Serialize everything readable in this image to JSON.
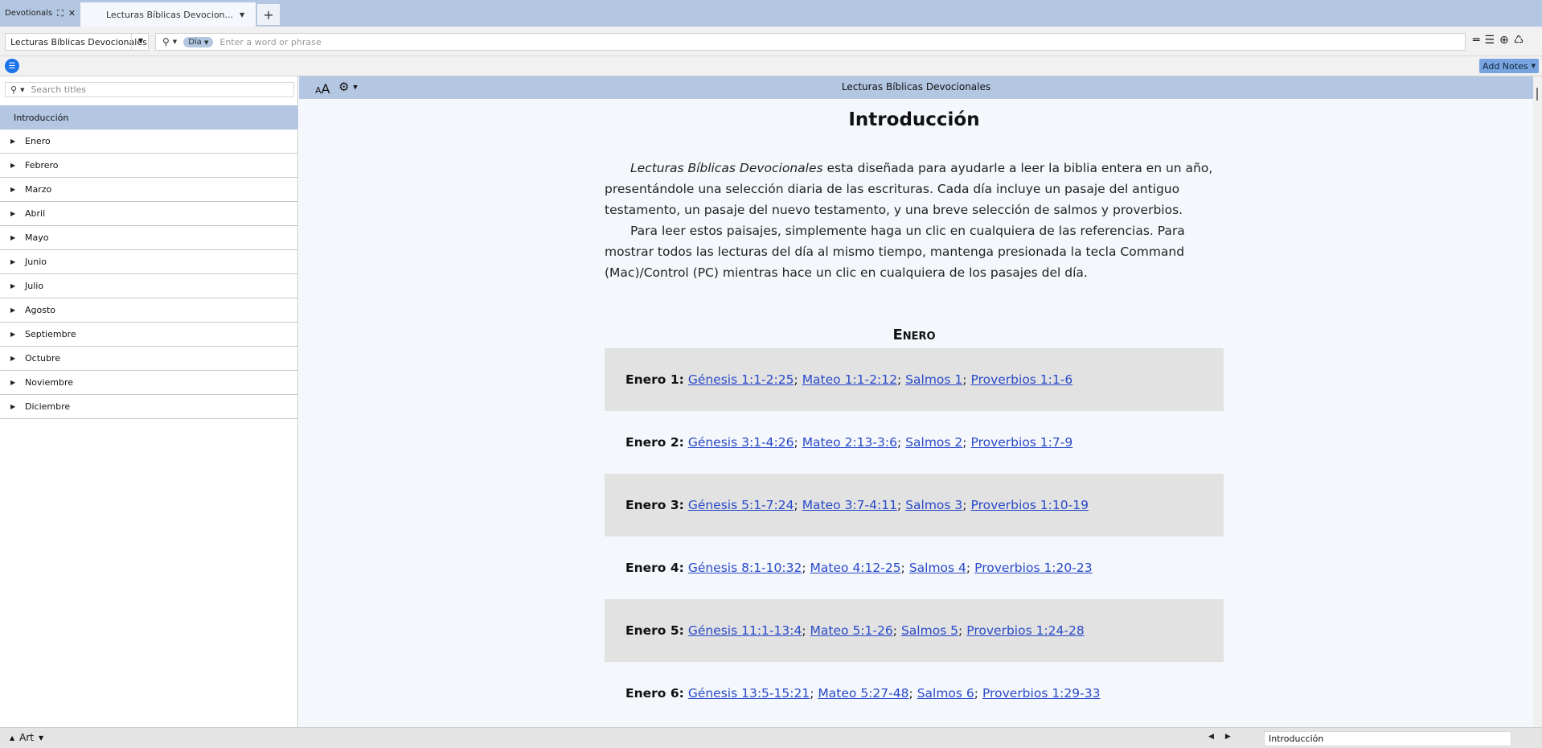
{
  "tabs": {
    "panel_tab_label": "Devotionals",
    "active_tab_label": "Lecturas Bíblicas Devocion...",
    "add_tab_label": "+"
  },
  "toolbar": {
    "resource_label": "Lecturas Bíblicas Devocionales",
    "search_scope": "Día",
    "search_placeholder": "Enter a word or phrase"
  },
  "subbar": {
    "add_notes_label": "Add Notes"
  },
  "sidebar": {
    "search_placeholder": "Search titles",
    "selected_item": "Introducción",
    "items": [
      "Enero",
      "Febrero",
      "Marzo",
      "Abril",
      "Mayo",
      "Junio",
      "Julio",
      "Agosto",
      "Septiembre",
      "Octubre",
      "Noviembre",
      "Diciembre"
    ]
  },
  "content": {
    "header_title": "Lecturas Bíblicas Devocionales",
    "font_small": "A",
    "font_large": "A",
    "page_heading": "Introducción",
    "intro_p1_italic": "Lecturas Bíblicas Devocionales",
    "intro_p1_rest": " esta diseñada para ayudarle a leer la biblia entera en un año, presentándole una selección diaria de las escrituras. Cada día incluye un pasaje del antiguo testamento, un pasaje del nuevo testamento, y una breve selección de salmos y proverbios.",
    "intro_p2": "Para leer estos paisajes, simplemente haga un clic en cualquiera de las referencias. Para mostrar todos las lecturas del día al mismo tiempo, mantenga presionada la tecla Command (Mac)/Control (PC) mientras hace un clic en cualquiera de los pasajes del día.",
    "month_heading": "Enero",
    "days": [
      {
        "label": "Enero 1:",
        "refs": [
          "Génesis 1:1-2:25",
          "Mateo 1:1-2:12",
          "Salmos 1",
          "Proverbios 1:1-6"
        ]
      },
      {
        "label": "Enero 2:",
        "refs": [
          "Génesis 3:1-4:26",
          "Mateo 2:13-3:6",
          "Salmos 2",
          "Proverbios 1:7-9"
        ]
      },
      {
        "label": "Enero 3:",
        "refs": [
          "Génesis 5:1-7:24",
          "Mateo 3:7-4:11",
          "Salmos 3",
          "Proverbios 1:10-19"
        ]
      },
      {
        "label": "Enero 4:",
        "refs": [
          "Génesis 8:1-10:32",
          "Mateo 4:12-25",
          "Salmos 4",
          "Proverbios 1:20-23"
        ]
      },
      {
        "label": "Enero 5:",
        "refs": [
          "Génesis 11:1-13:4",
          "Mateo 5:1-26",
          "Salmos 5",
          "Proverbios 1:24-28"
        ]
      },
      {
        "label": "Enero 6:",
        "refs": [
          "Génesis 13:5-15:21",
          "Mateo 5:27-48",
          "Salmos 6",
          "Proverbios 1:29-33"
        ]
      }
    ]
  },
  "statusbar": {
    "art_label": "Art",
    "location": "Introducción"
  },
  "icons": {
    "panel_expand": "expand-icon",
    "panel_close": "close-icon",
    "search": "magnifier-icon",
    "toc": "list-icon",
    "settings": "gear-icon"
  }
}
